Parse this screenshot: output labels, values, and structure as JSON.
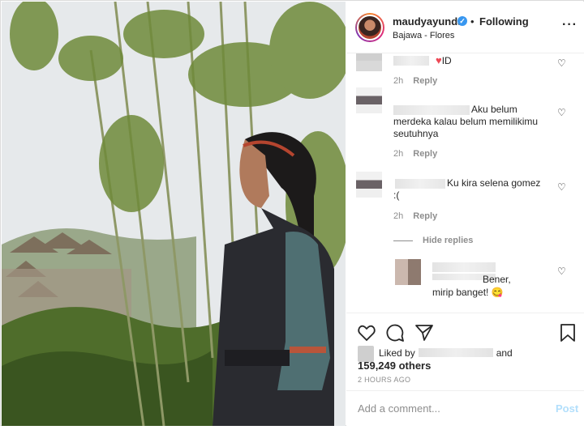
{
  "header": {
    "username": "maudyayunda",
    "separator": "•",
    "follow_status": "Following",
    "location": "Bajawa - Flores",
    "more_icon": "more-horizontal-icon"
  },
  "comments": [
    {
      "text": "ID",
      "time": "2h",
      "reply": "Reply"
    },
    {
      "text_line1": "Aku belum",
      "text_line2": "merdeka kalau belum memilikimu",
      "text_line3": "seutuhnya",
      "time": "2h",
      "reply": "Reply"
    },
    {
      "text_line1": "Ku kira selena gomez",
      "text_line2": ":(",
      "time": "2h",
      "reply": "Reply"
    }
  ],
  "hide_replies": "Hide replies",
  "reply_comment": {
    "line1": "Bener,",
    "line2": "mirip banget! 😋"
  },
  "actions": {
    "like_icon": "heart-icon",
    "comment_icon": "comment-icon",
    "share_icon": "share-icon",
    "save_icon": "bookmark-icon"
  },
  "likes": {
    "prefix": "Liked by",
    "suffix": "and",
    "count": "159,249 others"
  },
  "timestamp": "2 HOURS AGO",
  "add_comment": {
    "placeholder": "Add a comment...",
    "post_label": "Post"
  },
  "colors": {
    "accent": "#3897f0",
    "post_disabled": "#b2dffc",
    "like_red": "#ed4956"
  }
}
